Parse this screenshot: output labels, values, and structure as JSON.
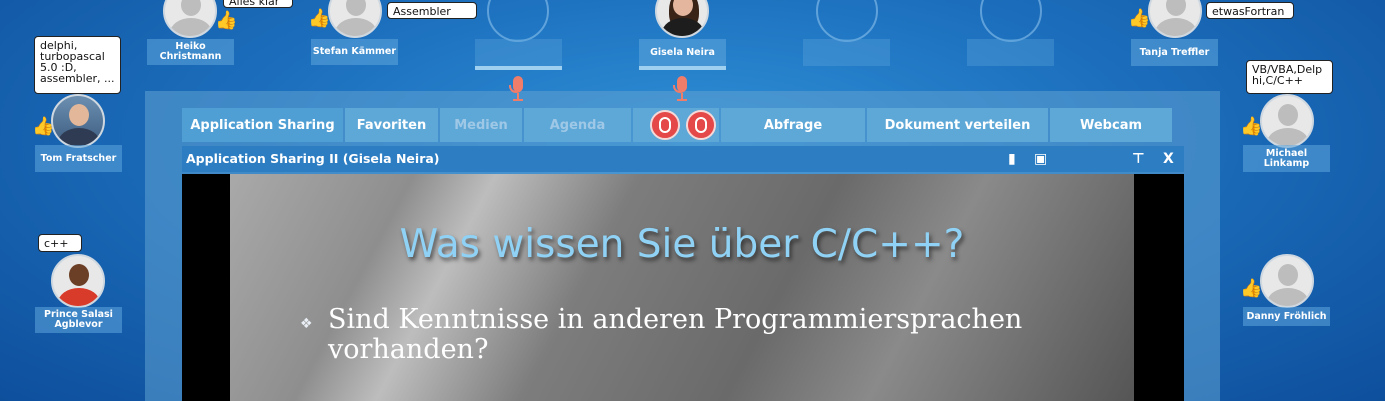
{
  "participants": [
    {
      "id": "heiko",
      "name": "Heiko\nChristmann",
      "bubble": "Alles klar"
    },
    {
      "id": "stefan",
      "name": "Stefan Kämmer",
      "bubble": "Assembler"
    },
    {
      "id": "gisela",
      "name": "Gisela Neira"
    },
    {
      "id": "tanja",
      "name": "Tanja Treffler",
      "bubble": "etwasFortran"
    },
    {
      "id": "tom",
      "name": "Tom Fratscher",
      "bubble": "delphi,\nturbopascal\n5.0 :D,\nassembler, ..."
    },
    {
      "id": "michael",
      "name": "Michael\nLinkamp",
      "bubble": "VB/VBA,Delp\nhi,C/C++"
    },
    {
      "id": "prince",
      "name": "Prince Salasi\nAgblevor",
      "bubble": "c++"
    },
    {
      "id": "danny",
      "name": "Danny Fröhlich"
    }
  ],
  "tabs": [
    {
      "label": "Application Sharing",
      "state": "active"
    },
    {
      "label": "Favoriten",
      "state": "normal"
    },
    {
      "label": "Medien",
      "state": "disabled"
    },
    {
      "label": "Agenda",
      "state": "disabled"
    },
    {
      "label": "",
      "state": "controls"
    },
    {
      "label": "Abfrage",
      "state": "normal"
    },
    {
      "label": "Dokument verteilen",
      "state": "normal"
    },
    {
      "label": "Webcam",
      "state": "normal"
    }
  ],
  "window": {
    "title": "Application Sharing II (Gisela Neira)",
    "icons": [
      "trash-icon",
      "camera-icon",
      "pin-icon",
      "close-icon"
    ],
    "close_label": "X"
  },
  "slide": {
    "title": "Was wissen Sie über C/C++?",
    "bullet_glyph": "❖",
    "bullet": "Sind Kenntnisse in anderen Programmiersprachen vorhanden?"
  },
  "colors": {
    "background": "#1c6fbd",
    "mic": "#f07c6a",
    "record": "#e54848",
    "slide_title": "#8fd2f5"
  }
}
